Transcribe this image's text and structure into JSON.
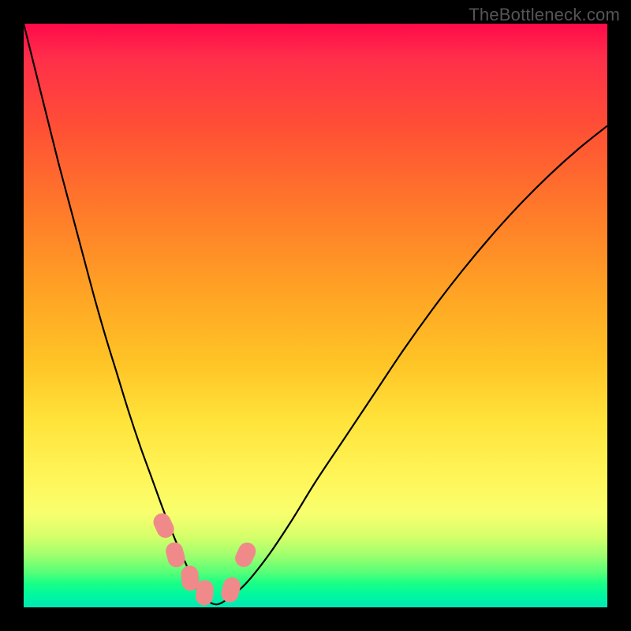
{
  "watermark": "TheBottleneck.com",
  "colors": {
    "curve": "#000000",
    "marker_fill": "#f08a8a",
    "marker_stroke": "#d06a6a"
  },
  "chart_data": {
    "type": "line",
    "title": "",
    "xlabel": "",
    "ylabel": "",
    "xlim": [
      0,
      100
    ],
    "ylim": [
      0,
      100
    ],
    "grid": false,
    "series": [
      {
        "name": "bottleneck-curve",
        "x": [
          0,
          2,
          4,
          6,
          8,
          10,
          12,
          14,
          16,
          18,
          20,
          22,
          24,
          26,
          28,
          29.5,
          31,
          33,
          35,
          38,
          42,
          46,
          50,
          55,
          60,
          65,
          70,
          75,
          80,
          85,
          90,
          95,
          100
        ],
        "values": [
          100,
          92,
          84,
          76,
          68.5,
          61,
          53.5,
          46.5,
          40,
          33.5,
          27.5,
          22,
          16.5,
          11.5,
          7,
          3.5,
          1.5,
          0.5,
          1.5,
          4,
          9,
          15,
          21.5,
          29,
          36.5,
          44,
          51,
          57.5,
          63.5,
          69,
          74,
          78.5,
          82.5
        ]
      }
    ],
    "markers": [
      {
        "x": 24.0,
        "y": 14.0
      },
      {
        "x": 26.0,
        "y": 9.0
      },
      {
        "x": 28.5,
        "y": 5.0
      },
      {
        "x": 31.0,
        "y": 2.5
      },
      {
        "x": 35.5,
        "y": 3.0
      },
      {
        "x": 38.0,
        "y": 9.0
      }
    ],
    "annotations": []
  }
}
